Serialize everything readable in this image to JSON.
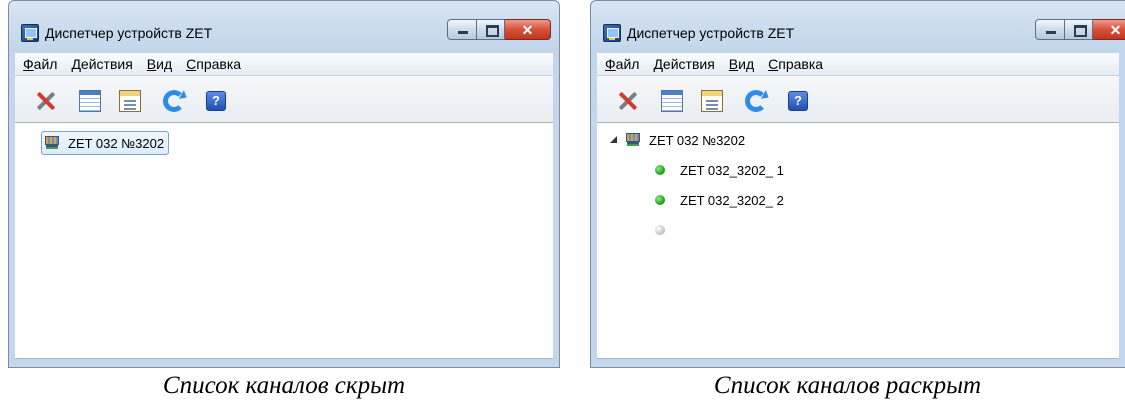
{
  "window": {
    "title": "Диспетчер устройств ZET",
    "menu": [
      "Файл",
      "Действия",
      "Вид",
      "Справка"
    ],
    "close_glyph": "✕",
    "toolbar_icons": [
      "tools-icon",
      "channel-table-icon",
      "properties-icon",
      "refresh-icon",
      "help-icon"
    ],
    "help_glyph": "?"
  },
  "left": {
    "device": "ZET 032 №3202",
    "caption": "Список каналов скрыт"
  },
  "right": {
    "device": "ZET 032 №3202",
    "channels": [
      "ZET 032_3202_ 1",
      "ZET 032_3202_ 2",
      ""
    ],
    "caption": "Список каналов раскрыт"
  },
  "colors": {
    "channel_active": "#1fa81f",
    "channel_inactive": "#c8c8c8",
    "titlebar": "#cadbee"
  }
}
